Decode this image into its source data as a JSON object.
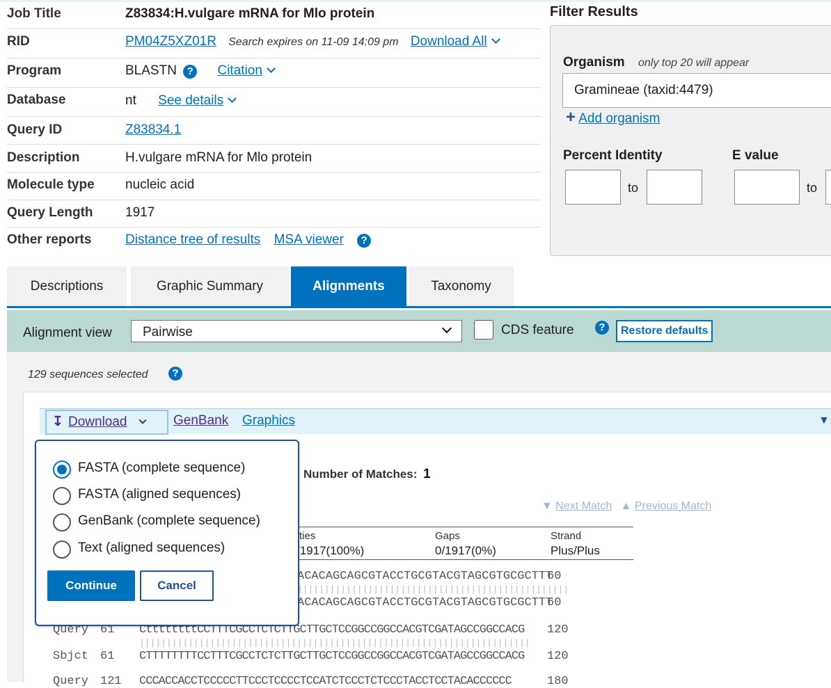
{
  "summary": {
    "rows": [
      {
        "label": "Job Title",
        "value": "Z83834:H.vulgare mRNA for Mlo protein"
      },
      {
        "label": "RID",
        "rid": "PM04Z5XZ01R",
        "expires": "Search expires on 11-09 14:09 pm",
        "download_all": "Download All"
      },
      {
        "label": "Program",
        "value": "BLASTN",
        "citation": "Citation"
      },
      {
        "label": "Database",
        "value": "nt",
        "details": "See details"
      },
      {
        "label": "Query ID",
        "link": "Z83834.1"
      },
      {
        "label": "Description",
        "value": "H.vulgare mRNA for Mlo protein"
      },
      {
        "label": "Molecule type",
        "value": "nucleic acid"
      },
      {
        "label": "Query Length",
        "value": "1917"
      },
      {
        "label": "Other reports",
        "tree": "Distance tree of results",
        "msa": "MSA viewer"
      }
    ]
  },
  "filter": {
    "title": "Filter Results",
    "organism_label": "Organism",
    "organism_hint": "only top 20 will appear",
    "organism_value": "Gramineae (taxid:4479)",
    "add_organism": "Add organism",
    "percent_identity": "Percent Identity",
    "evalue": "E value",
    "to": "to"
  },
  "tabs": [
    "Descriptions",
    "Graphic Summary",
    "Alignments",
    "Taxonomy"
  ],
  "alignment_view": {
    "label": "Alignment view",
    "selected": "Pairwise",
    "cds_label": "CDS feature",
    "restore": "Restore defaults"
  },
  "selected_count": "129 sequences selected",
  "hit": {
    "download": "Download",
    "genbank": "GenBank",
    "graphics": "Graphics",
    "matches_label": "Number of Matches:",
    "matches_value": "1",
    "next_match": "Next Match",
    "prev_match": "Previous Match",
    "col_identities_partial": "ties",
    "col_gaps": "Gaps",
    "col_strand": "Strand",
    "identities_value_partial": "/1917(100%)",
    "gaps_value": "0/1917(0%)",
    "strand_value": "Plus/Plus"
  },
  "alignment": [
    {
      "label": "",
      "start": "",
      "seq": "ACACAGCAGCGTACCTGCGTACGTAGCGTGCGCTTT",
      "end": "60"
    },
    {
      "label": "",
      "start": "",
      "seq": "ACACAGCAGCGTACCTGCGTACGTAGCGTGCGCTTT",
      "end": "60"
    },
    {
      "label": "Query",
      "start": "61",
      "seq": "CttttttttCCTTTCGCCTCTCTTGCTTGCTCCGGCCGGCCACGTCGATAGCCGGCCACG",
      "end": "120"
    },
    {
      "label": "Sbjct",
      "start": "61",
      "seq": "CTTTTTTTTCCTTTCGCCTCTCTTGCTTGCTCCGGCCGGCCACGTCGATAGCCGGCCACG",
      "end": "120"
    },
    {
      "label": "Query",
      "start": "121",
      "seq": "CCCACCACCTCCCCCTTCCCTCCCCTCCATCTCCCTCTCCCTACCTCCTACACCCCCC",
      "end": "180"
    }
  ],
  "popup": {
    "options": [
      "FASTA (complete sequence)",
      "FASTA (aligned sequences)",
      "GenBank (complete sequence)",
      "Text (aligned sequences)"
    ],
    "selected_index": 0,
    "continue": "Continue",
    "cancel": "Cancel"
  },
  "colors": {
    "accent": "#0071bc",
    "tab_bar": "#0071bc",
    "view_bar": "#bcd8d3",
    "hit_bar": "#e1f3f8"
  }
}
